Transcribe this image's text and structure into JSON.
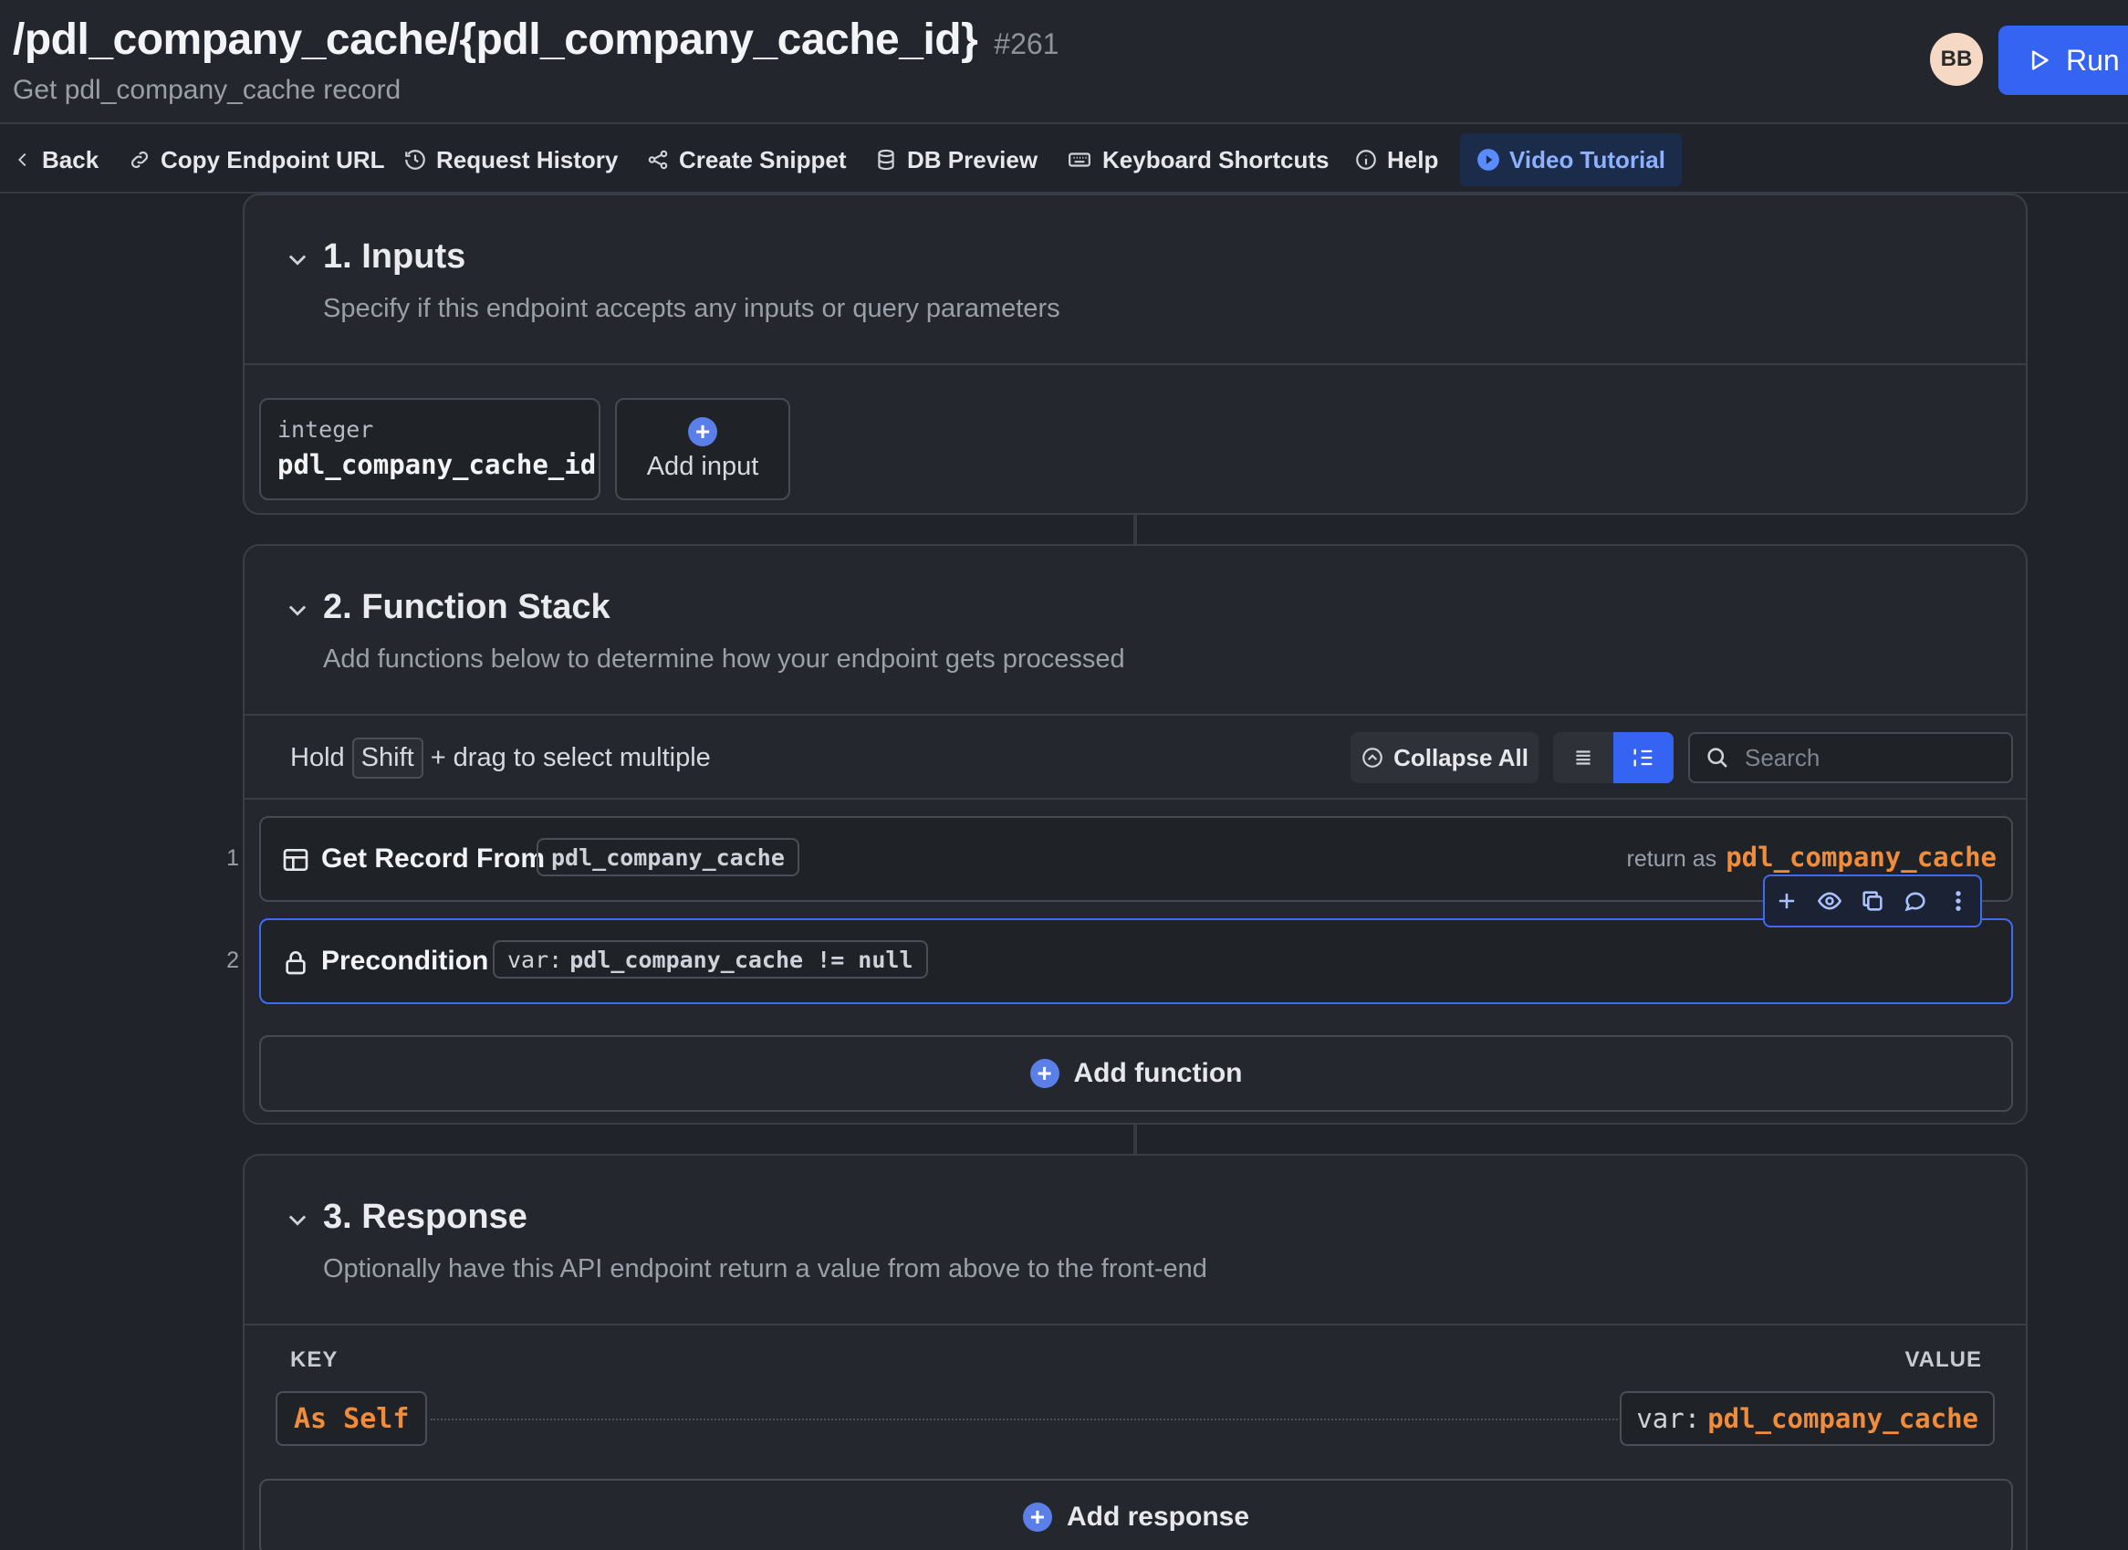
{
  "header": {
    "title": "/pdl_company_cache/{pdl_company_cache_id}",
    "id": "#261",
    "subtitle": "Get pdl_company_cache record",
    "avatar_initials": "BB",
    "run_label": "Run"
  },
  "toolbar": {
    "back": "Back",
    "copy_url": "Copy Endpoint URL",
    "history": "Request History",
    "snippet": "Create Snippet",
    "db_preview": "DB Preview",
    "shortcuts": "Keyboard Shortcuts",
    "help": "Help",
    "video": "Video Tutorial"
  },
  "inputs_section": {
    "title": "1. Inputs",
    "subtitle": "Specify if this endpoint accepts any inputs or query parameters",
    "inputs": [
      {
        "type": "integer",
        "name": "pdl_company_cache_id"
      }
    ],
    "add_label": "Add input"
  },
  "function_stack": {
    "title": "2. Function Stack",
    "subtitle": "Add functions below to determine how your endpoint gets processed",
    "hint_prefix": "Hold",
    "hint_key": "Shift",
    "hint_suffix": "+ drag to select multiple",
    "collapse_all": "Collapse All",
    "search_placeholder": "Search",
    "functions": [
      {
        "number": "1",
        "label": "Get Record From",
        "pill": "pdl_company_cache",
        "return_label": "return as",
        "return_var": "pdl_company_cache"
      },
      {
        "number": "2",
        "label": "Precondition",
        "pill_prefix": "var:",
        "pill": "pdl_company_cache != null"
      }
    ],
    "add_label": "Add function"
  },
  "response_section": {
    "title": "3. Response",
    "subtitle": "Optionally have this API endpoint return a value from above to the front-end",
    "key_header": "KEY",
    "value_header": "VALUE",
    "key": "As Self",
    "value_prefix": "var:",
    "value": "pdl_company_cache",
    "add_label": "Add response"
  },
  "colors": {
    "accent": "#3563f2",
    "variable": "#f08c3a",
    "background": "#202329"
  }
}
